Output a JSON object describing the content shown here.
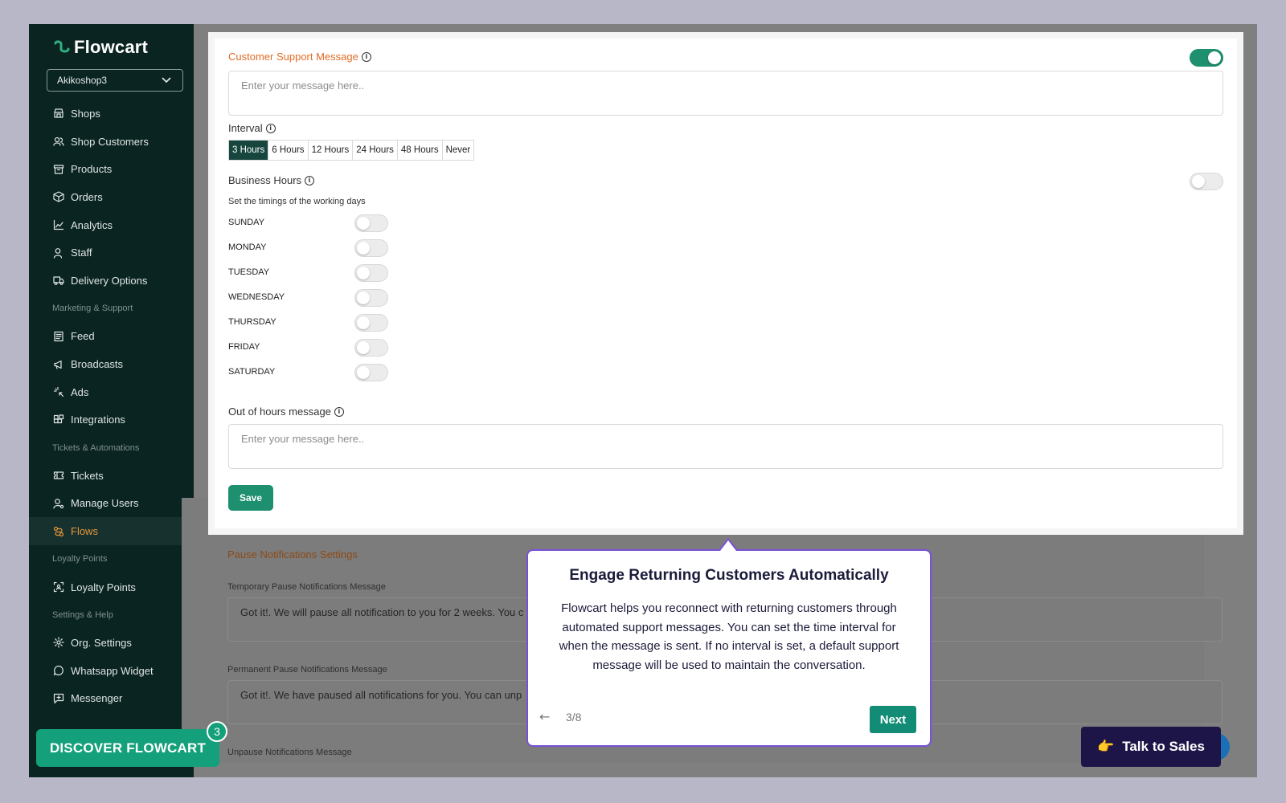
{
  "app": {
    "name": "Flowcart",
    "shop_selected": "Akikoshop3"
  },
  "sidebar": {
    "items": [
      {
        "type": "item",
        "label": "Shops",
        "icon": "store-icon"
      },
      {
        "type": "item",
        "label": "Shop Customers",
        "icon": "users-icon"
      },
      {
        "type": "item",
        "label": "Products",
        "icon": "archive-icon"
      },
      {
        "type": "item",
        "label": "Orders",
        "icon": "box-icon"
      },
      {
        "type": "item",
        "label": "Analytics",
        "icon": "chart-icon"
      },
      {
        "type": "item",
        "label": "Staff",
        "icon": "user-icon"
      },
      {
        "type": "item",
        "label": "Delivery Options",
        "icon": "truck-icon"
      },
      {
        "type": "section",
        "label": "Marketing & Support"
      },
      {
        "type": "item",
        "label": "Feed",
        "icon": "newspaper-icon"
      },
      {
        "type": "item",
        "label": "Broadcasts",
        "icon": "megaphone-icon"
      },
      {
        "type": "item",
        "label": "Ads",
        "icon": "sparkle-icon"
      },
      {
        "type": "item",
        "label": "Integrations",
        "icon": "blocks-icon"
      },
      {
        "type": "section",
        "label": "Tickets & Automations"
      },
      {
        "type": "item",
        "label": "Tickets",
        "icon": "ticket-icon"
      },
      {
        "type": "item",
        "label": "Manage Users",
        "icon": "user-cog-icon"
      },
      {
        "type": "item",
        "label": "Flows",
        "icon": "flows-icon",
        "active": true
      },
      {
        "type": "section",
        "label": "Loyalty Points"
      },
      {
        "type": "item",
        "label": "Loyalty Points",
        "icon": "scan-icon"
      },
      {
        "type": "section",
        "label": "Settings & Help"
      },
      {
        "type": "item",
        "label": "Org. Settings",
        "icon": "gear-icon"
      },
      {
        "type": "item",
        "label": "Whatsapp Widget",
        "icon": "chat-icon"
      },
      {
        "type": "item",
        "label": "Messenger",
        "icon": "message-square-icon"
      }
    ]
  },
  "support": {
    "title": "Customer Support Message",
    "enabled": true,
    "placeholder": "Enter your message here..",
    "interval_label": "Interval",
    "intervals": [
      "3 Hours",
      "6 Hours",
      "12 Hours",
      "24 Hours",
      "48 Hours",
      "Never"
    ],
    "interval_selected": "3 Hours",
    "business_hours_label": "Business Hours",
    "business_hours_enabled": false,
    "business_hours_note": "Set the timings of the working days",
    "days": [
      {
        "name": "SUNDAY",
        "on": false
      },
      {
        "name": "MONDAY",
        "on": false
      },
      {
        "name": "TUESDAY",
        "on": false
      },
      {
        "name": "WEDNESDAY",
        "on": false
      },
      {
        "name": "THURSDAY",
        "on": false
      },
      {
        "name": "FRIDAY",
        "on": false
      },
      {
        "name": "SATURDAY",
        "on": false
      }
    ],
    "out_of_hours_label": "Out of hours message",
    "out_of_hours_placeholder": "Enter your message here..",
    "save_label": "Save"
  },
  "pause": {
    "title": "Pause Notifications Settings",
    "temporary_label": "Temporary Pause Notifications Message",
    "temporary_value": "Got it!. We will pause all notification to you for 2 weeks. You c",
    "permanent_label": "Permanent Pause Notifications Message",
    "permanent_value": "Got it!. We have paused all notifications for you. You can unp",
    "unpause_label": "Unpause Notifications Message"
  },
  "tour": {
    "title": "Engage Returning Customers Automatically",
    "body": "Flowcart helps you reconnect with returning customers through automated support messages. You can set the time interval for when the message is sent. If no interval is set, a default support message will be used to maintain the conversation.",
    "back_icon": "←",
    "step": "3/8",
    "next_label": "Next"
  },
  "floating": {
    "discover_label": "DISCOVER FLOWCART",
    "discover_badge": "3",
    "sales_emoji": "👉",
    "sales_label": "Talk to Sales"
  },
  "colors": {
    "accent": "#1e8f6f",
    "sidebar_bg": "#0a2421",
    "section_title": "#e06d26",
    "tour_border": "#7a4fd8"
  }
}
